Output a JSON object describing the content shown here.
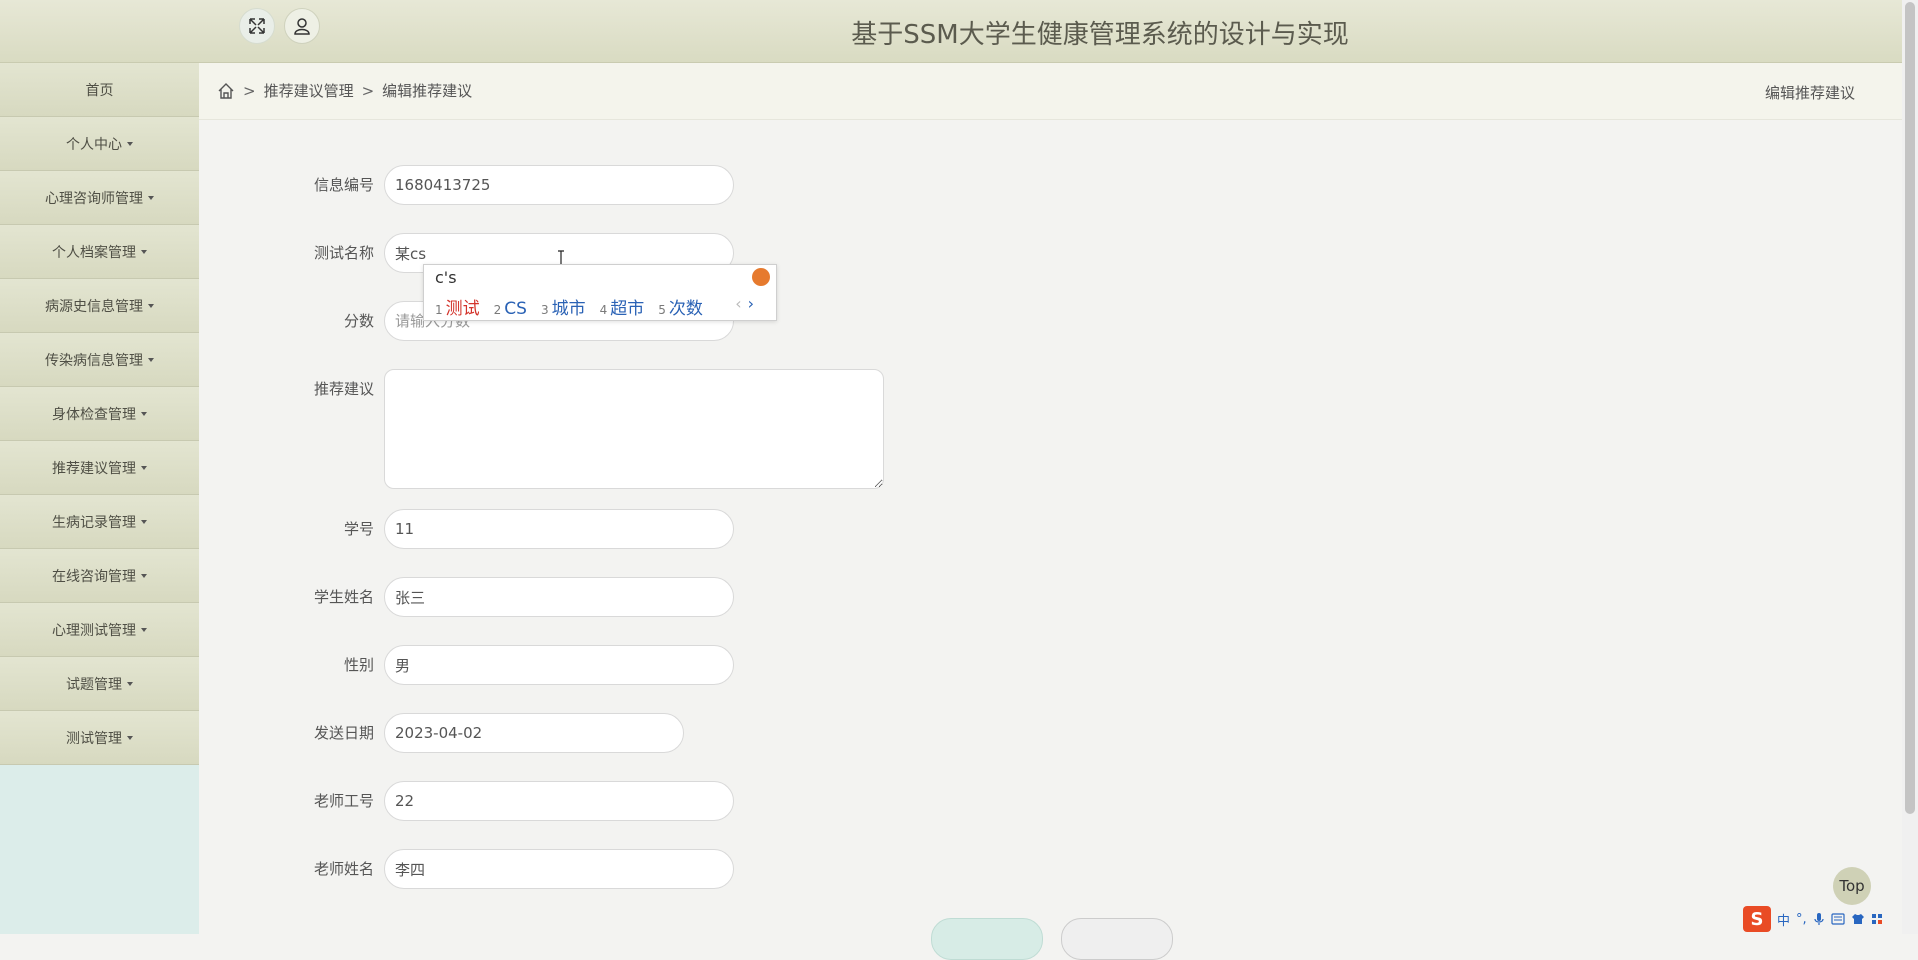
{
  "header": {
    "title": "基于SSM大学生健康管理系统的设计与实现"
  },
  "sidebar": {
    "items": [
      {
        "label": "首页",
        "caret": false
      },
      {
        "label": "个人中心",
        "caret": true
      },
      {
        "label": "心理咨询师管理",
        "caret": true
      },
      {
        "label": "个人档案管理",
        "caret": true
      },
      {
        "label": "病源史信息管理",
        "caret": true
      },
      {
        "label": "传染病信息管理",
        "caret": true
      },
      {
        "label": "身体检查管理",
        "caret": true
      },
      {
        "label": "推荐建议管理",
        "caret": true
      },
      {
        "label": "生病记录管理",
        "caret": true
      },
      {
        "label": "在线咨询管理",
        "caret": true
      },
      {
        "label": "心理测试管理",
        "caret": true
      },
      {
        "label": "试题管理",
        "caret": true
      },
      {
        "label": "测试管理",
        "caret": true
      }
    ]
  },
  "breadcrumb": {
    "sep": ">",
    "level1": "推荐建议管理",
    "level2": "编辑推荐建议"
  },
  "page_title": "编辑推荐建议",
  "form": {
    "info_id": {
      "label": "信息编号",
      "value": "1680413725"
    },
    "test_name": {
      "label": "测试名称",
      "value": "某cs"
    },
    "score": {
      "label": "分数",
      "value": "",
      "placeholder": "请输入分数"
    },
    "advice": {
      "label": "推荐建议",
      "value": ""
    },
    "student_no": {
      "label": "学号",
      "value": "11"
    },
    "student_name": {
      "label": "学生姓名",
      "value": "张三"
    },
    "gender": {
      "label": "性别",
      "value": "男"
    },
    "send_date": {
      "label": "发送日期",
      "value": "2023-04-02"
    },
    "teacher_no": {
      "label": "老师工号",
      "value": "22"
    },
    "teacher_name": {
      "label": "老师姓名",
      "value": "李四"
    }
  },
  "ime": {
    "composition": "c's",
    "candidates": [
      {
        "num": "1",
        "text": "测试"
      },
      {
        "num": "2",
        "text": "CS"
      },
      {
        "num": "3",
        "text": "城市"
      },
      {
        "num": "4",
        "text": "超市"
      },
      {
        "num": "5",
        "text": "次数"
      }
    ],
    "prev": "‹",
    "next": "›"
  },
  "top_button": "Top",
  "tray": {
    "ime_label": "中",
    "punct": "°,"
  }
}
